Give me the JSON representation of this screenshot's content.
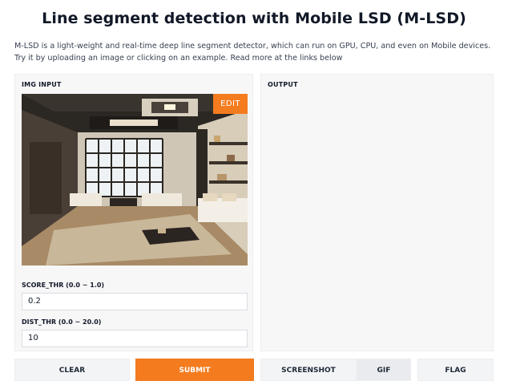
{
  "page": {
    "title": "Line segment detection with Mobile LSD (M-LSD)",
    "description": "M-LSD is a light-weight and real-time deep line segment detector, which can run on GPU, CPU, and even on Mobile devices. Try it by uploading an image or clicking on an example. Read more at the links below"
  },
  "input_panel": {
    "label": "IMG INPUT",
    "edit_label": "EDIT",
    "image_alt": "living room interior photo"
  },
  "output_panel": {
    "label": "OUTPUT"
  },
  "fields": [
    {
      "label": "SCORE_THR (0.0 ~ 1.0)",
      "value": "0.2"
    },
    {
      "label": "DIST_THR (0.0 ~ 20.0)",
      "value": "10"
    }
  ],
  "buttons": {
    "clear": "CLEAR",
    "submit": "SUBMIT",
    "screenshot": "SCREENSHOT",
    "gif": "GIF",
    "flag": "FLAG"
  },
  "colors": {
    "accent": "#f47c1f",
    "panel_bg": "#f7f7f8"
  }
}
